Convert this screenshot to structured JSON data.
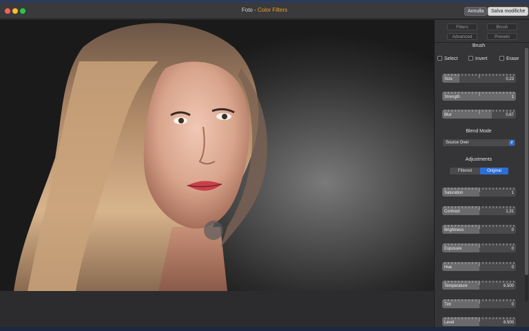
{
  "window": {
    "title_app": "Foto",
    "title_sep": " - ",
    "title_accent": "Color Filters",
    "accent_color": "#f0a020",
    "cancel_label": "Annulla",
    "save_label": "Salva modifiche"
  },
  "tabs": {
    "filters": "Filters",
    "brush": "Brush",
    "advanced": "Advanced",
    "presets": "Presets"
  },
  "brush": {
    "title": "Brush",
    "select_label": "Select",
    "invert_label": "Invert",
    "erase_label": "Erase",
    "sliders": [
      {
        "label": "Size",
        "value": "0,23",
        "fraction": 0.23
      },
      {
        "label": "Strength",
        "value": "1",
        "fraction": 1.0
      },
      {
        "label": "Blur",
        "value": "0,67",
        "fraction": 0.67
      }
    ]
  },
  "blend": {
    "title": "Blend Mode",
    "selected": "Source Over"
  },
  "adjustments": {
    "title": "Adjustments",
    "filtered_label": "Filtered",
    "original_label": "Original",
    "active_color": "#2d6ed4",
    "sliders": [
      {
        "label": "Saturation",
        "value": "1",
        "fraction": 0.5
      },
      {
        "label": "Contrast",
        "value": "1,31",
        "fraction": 0.5
      },
      {
        "label": "Brightness",
        "value": "0",
        "fraction": 0.5
      },
      {
        "label": "Exposure",
        "value": "0",
        "fraction": 0.5
      },
      {
        "label": "Hue",
        "value": "0",
        "fraction": 0.5
      },
      {
        "label": "Temperature",
        "value": "6.500",
        "fraction": 0.5
      },
      {
        "label": "Tint",
        "value": "0",
        "fraction": 0.5
      },
      {
        "label": "Level",
        "value": "6.500",
        "fraction": 0.5
      }
    ]
  }
}
